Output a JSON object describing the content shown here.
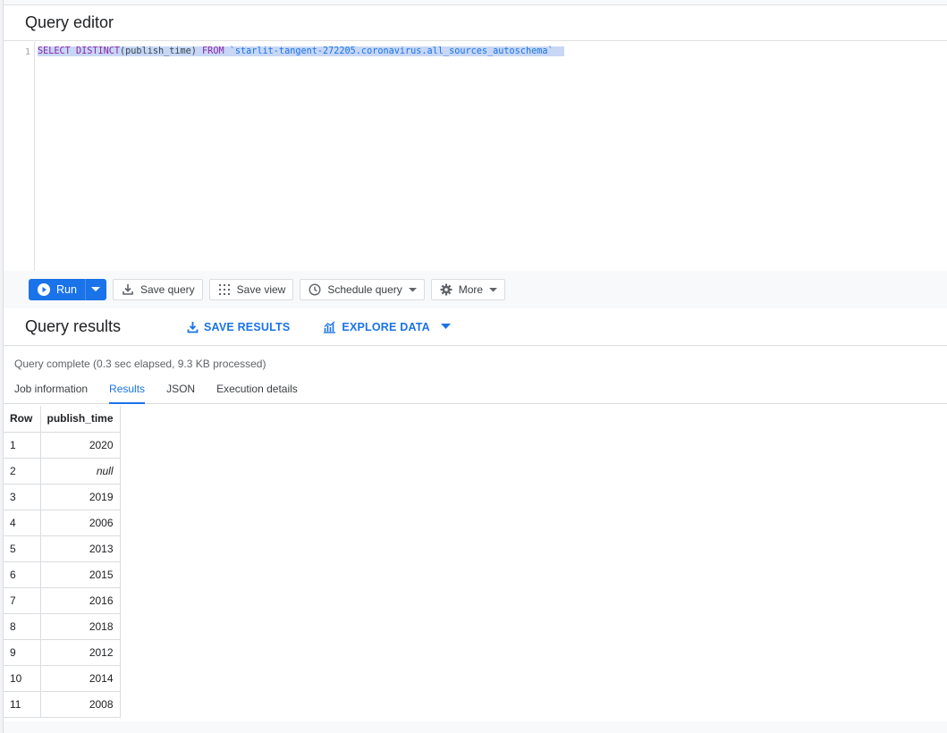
{
  "editor": {
    "title": "Query editor",
    "line_number": "1",
    "query": {
      "kw_select": "SELECT",
      "kw_distinct": "DISTINCT",
      "plain_open": "(publish_time)",
      "kw_from": "FROM",
      "table_ref": "`starlit-tangent-272205.coronavirus.all_sources_autoschema`"
    }
  },
  "toolbar": {
    "run_label": "Run",
    "save_query_label": "Save query",
    "save_view_label": "Save view",
    "schedule_query_label": "Schedule query",
    "more_label": "More"
  },
  "results": {
    "title": "Query results",
    "save_results_label": "SAVE RESULTS",
    "explore_data_label": "EXPLORE DATA",
    "status": "Query complete (0.3 sec elapsed, 9.3 KB processed)",
    "tabs": [
      {
        "label": "Job information"
      },
      {
        "label": "Results"
      },
      {
        "label": "JSON"
      },
      {
        "label": "Execution details"
      }
    ],
    "active_tab": "Results",
    "columns": [
      "Row",
      "publish_time"
    ],
    "rows": [
      {
        "row": "1",
        "value": "2020"
      },
      {
        "row": "2",
        "value": "null"
      },
      {
        "row": "3",
        "value": "2019"
      },
      {
        "row": "4",
        "value": "2006"
      },
      {
        "row": "5",
        "value": "2013"
      },
      {
        "row": "6",
        "value": "2015"
      },
      {
        "row": "7",
        "value": "2016"
      },
      {
        "row": "8",
        "value": "2018"
      },
      {
        "row": "9",
        "value": "2012"
      },
      {
        "row": "10",
        "value": "2014"
      },
      {
        "row": "11",
        "value": "2008"
      }
    ]
  },
  "colors": {
    "accent": "#1a73e8",
    "keyword": "#8e24aa",
    "selection": "#c7d7f5"
  }
}
